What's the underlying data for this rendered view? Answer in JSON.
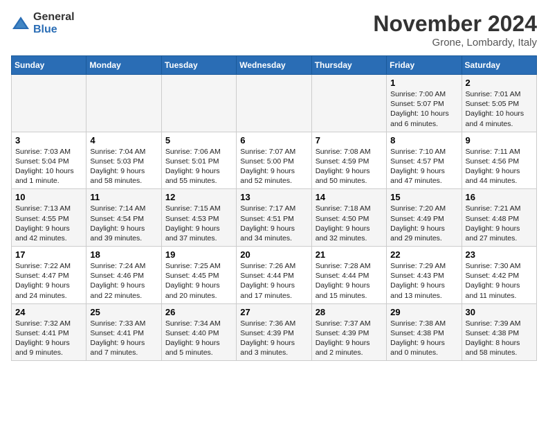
{
  "header": {
    "logo_general": "General",
    "logo_blue": "Blue",
    "month_title": "November 2024",
    "location": "Grone, Lombardy, Italy"
  },
  "weekdays": [
    "Sunday",
    "Monday",
    "Tuesday",
    "Wednesday",
    "Thursday",
    "Friday",
    "Saturday"
  ],
  "weeks": [
    [
      {
        "day": "",
        "info": ""
      },
      {
        "day": "",
        "info": ""
      },
      {
        "day": "",
        "info": ""
      },
      {
        "day": "",
        "info": ""
      },
      {
        "day": "",
        "info": ""
      },
      {
        "day": "1",
        "info": "Sunrise: 7:00 AM\nSunset: 5:07 PM\nDaylight: 10 hours\nand 6 minutes."
      },
      {
        "day": "2",
        "info": "Sunrise: 7:01 AM\nSunset: 5:05 PM\nDaylight: 10 hours\nand 4 minutes."
      }
    ],
    [
      {
        "day": "3",
        "info": "Sunrise: 7:03 AM\nSunset: 5:04 PM\nDaylight: 10 hours\nand 1 minute."
      },
      {
        "day": "4",
        "info": "Sunrise: 7:04 AM\nSunset: 5:03 PM\nDaylight: 9 hours\nand 58 minutes."
      },
      {
        "day": "5",
        "info": "Sunrise: 7:06 AM\nSunset: 5:01 PM\nDaylight: 9 hours\nand 55 minutes."
      },
      {
        "day": "6",
        "info": "Sunrise: 7:07 AM\nSunset: 5:00 PM\nDaylight: 9 hours\nand 52 minutes."
      },
      {
        "day": "7",
        "info": "Sunrise: 7:08 AM\nSunset: 4:59 PM\nDaylight: 9 hours\nand 50 minutes."
      },
      {
        "day": "8",
        "info": "Sunrise: 7:10 AM\nSunset: 4:57 PM\nDaylight: 9 hours\nand 47 minutes."
      },
      {
        "day": "9",
        "info": "Sunrise: 7:11 AM\nSunset: 4:56 PM\nDaylight: 9 hours\nand 44 minutes."
      }
    ],
    [
      {
        "day": "10",
        "info": "Sunrise: 7:13 AM\nSunset: 4:55 PM\nDaylight: 9 hours\nand 42 minutes."
      },
      {
        "day": "11",
        "info": "Sunrise: 7:14 AM\nSunset: 4:54 PM\nDaylight: 9 hours\nand 39 minutes."
      },
      {
        "day": "12",
        "info": "Sunrise: 7:15 AM\nSunset: 4:53 PM\nDaylight: 9 hours\nand 37 minutes."
      },
      {
        "day": "13",
        "info": "Sunrise: 7:17 AM\nSunset: 4:51 PM\nDaylight: 9 hours\nand 34 minutes."
      },
      {
        "day": "14",
        "info": "Sunrise: 7:18 AM\nSunset: 4:50 PM\nDaylight: 9 hours\nand 32 minutes."
      },
      {
        "day": "15",
        "info": "Sunrise: 7:20 AM\nSunset: 4:49 PM\nDaylight: 9 hours\nand 29 minutes."
      },
      {
        "day": "16",
        "info": "Sunrise: 7:21 AM\nSunset: 4:48 PM\nDaylight: 9 hours\nand 27 minutes."
      }
    ],
    [
      {
        "day": "17",
        "info": "Sunrise: 7:22 AM\nSunset: 4:47 PM\nDaylight: 9 hours\nand 24 minutes."
      },
      {
        "day": "18",
        "info": "Sunrise: 7:24 AM\nSunset: 4:46 PM\nDaylight: 9 hours\nand 22 minutes."
      },
      {
        "day": "19",
        "info": "Sunrise: 7:25 AM\nSunset: 4:45 PM\nDaylight: 9 hours\nand 20 minutes."
      },
      {
        "day": "20",
        "info": "Sunrise: 7:26 AM\nSunset: 4:44 PM\nDaylight: 9 hours\nand 17 minutes."
      },
      {
        "day": "21",
        "info": "Sunrise: 7:28 AM\nSunset: 4:44 PM\nDaylight: 9 hours\nand 15 minutes."
      },
      {
        "day": "22",
        "info": "Sunrise: 7:29 AM\nSunset: 4:43 PM\nDaylight: 9 hours\nand 13 minutes."
      },
      {
        "day": "23",
        "info": "Sunrise: 7:30 AM\nSunset: 4:42 PM\nDaylight: 9 hours\nand 11 minutes."
      }
    ],
    [
      {
        "day": "24",
        "info": "Sunrise: 7:32 AM\nSunset: 4:41 PM\nDaylight: 9 hours\nand 9 minutes."
      },
      {
        "day": "25",
        "info": "Sunrise: 7:33 AM\nSunset: 4:41 PM\nDaylight: 9 hours\nand 7 minutes."
      },
      {
        "day": "26",
        "info": "Sunrise: 7:34 AM\nSunset: 4:40 PM\nDaylight: 9 hours\nand 5 minutes."
      },
      {
        "day": "27",
        "info": "Sunrise: 7:36 AM\nSunset: 4:39 PM\nDaylight: 9 hours\nand 3 minutes."
      },
      {
        "day": "28",
        "info": "Sunrise: 7:37 AM\nSunset: 4:39 PM\nDaylight: 9 hours\nand 2 minutes."
      },
      {
        "day": "29",
        "info": "Sunrise: 7:38 AM\nSunset: 4:38 PM\nDaylight: 9 hours\nand 0 minutes."
      },
      {
        "day": "30",
        "info": "Sunrise: 7:39 AM\nSunset: 4:38 PM\nDaylight: 8 hours\nand 58 minutes."
      }
    ]
  ]
}
